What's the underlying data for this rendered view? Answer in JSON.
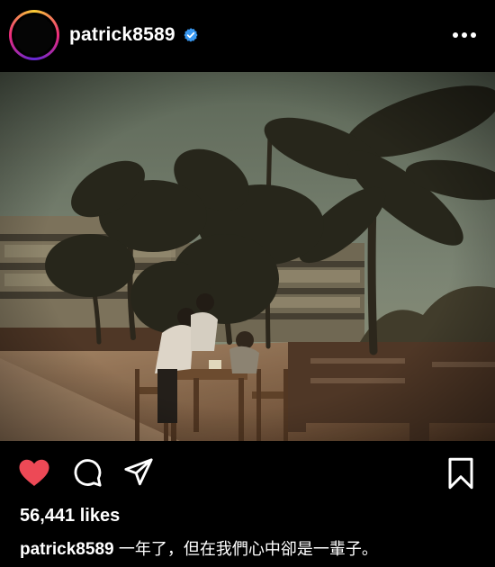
{
  "post": {
    "username": "patrick8589",
    "verified_icon": "verified-badge-icon",
    "more_icon": "more-options-icon",
    "photo_alt": "Photo: two people at a desk by palm trees",
    "likes_text": "56,441 likes",
    "caption_user": "patrick8589",
    "caption_text": "一年了，但在我們心中卻是一輩子。",
    "liked": true
  },
  "actions": {
    "like_icon": "heart-icon",
    "comment_icon": "comment-icon",
    "share_icon": "share-icon",
    "save_icon": "bookmark-icon"
  },
  "colors": {
    "background": "#000000",
    "like": "#ed4956",
    "verified": "#3897f0"
  }
}
